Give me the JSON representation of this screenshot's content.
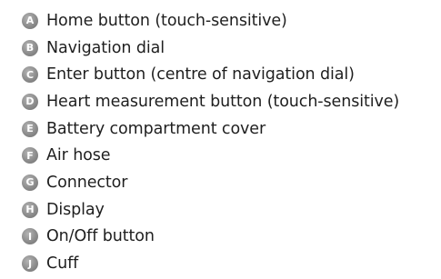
{
  "legend": {
    "items": [
      {
        "letter": "A",
        "text": "Home button (touch-sensitive)"
      },
      {
        "letter": "B",
        "text": "Navigation dial"
      },
      {
        "letter": "C",
        "text": "Enter button (centre of navigation dial)"
      },
      {
        "letter": "D",
        "text": "Heart measurement button (touch-sensitive)"
      },
      {
        "letter": "E",
        "text": "Battery compartment cover"
      },
      {
        "letter": "F",
        "text": "Air hose"
      },
      {
        "letter": "G",
        "text": "Connector"
      },
      {
        "letter": "H",
        "text": "Display"
      },
      {
        "letter": "I",
        "text": "On/Off button"
      },
      {
        "letter": "J",
        "text": "Cuff"
      }
    ]
  },
  "colors": {
    "badge": "#8c8c8c",
    "text": "#1f1f1f",
    "background": "#ffffff"
  }
}
